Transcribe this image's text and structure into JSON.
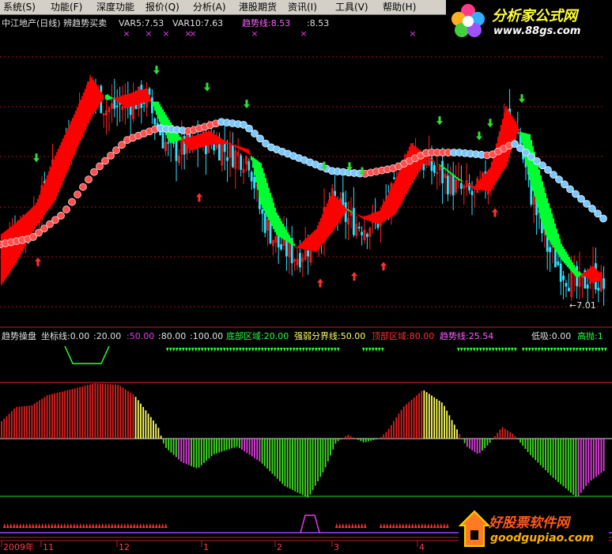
{
  "menu": [
    "系统(S)",
    "功能(F)",
    "深度功能",
    "报价(Q)",
    "分析(A)",
    "港股期货",
    "资讯(I)",
    "工具(V)",
    "帮助(H)"
  ],
  "logo": {
    "title": "分析家公式网",
    "url": "www.88gs.com"
  },
  "logo2": {
    "title": "好股票软件网",
    "url": "goodgupiao.com"
  },
  "main_header": {
    "title": "中江地产(日线) 辨趋势买卖",
    "var5_label": "VAR5:",
    "var5_value": "7.53",
    "var10_label": "VAR10:",
    "var10_value": "7.63",
    "trend_label": "趋势线:",
    "trend_value": "8.53",
    "trend2_value": ":8.53",
    "low_label": "←7.01"
  },
  "sub_header": {
    "name": "趋势操盘",
    "axis_label": "坐标线:0.00",
    "v20": ":20.00",
    "v50": ":50.00",
    "v80": ":80.00",
    "v100": ":100.00",
    "bottom_zone": "底部区域:20.00",
    "strength_line": "强弱分界线:50.00",
    "top_zone": "顶部区域:80.00",
    "trend_line": "趋势线:25.54",
    "low_absorb": "低吸:0.00",
    "high_throw": "高抛:1"
  },
  "time_axis": {
    "labels": [
      "2009年",
      "11",
      "12",
      "1",
      "2",
      "3",
      "4"
    ]
  },
  "colors": {
    "rise": "#ff2020",
    "fall": "#30e0ff",
    "up_band": "#ff0000",
    "down_band": "#00ff30",
    "ma_red": "#ff5050",
    "ma_blue": "#7ac8ff",
    "hist_red": "#e02020",
    "hist_yellow": "#ffff60",
    "hist_green": "#40e020",
    "hist_magenta": "#e040e0"
  },
  "chart_data": {
    "type": "line",
    "x": [
      "2009-10",
      "2009-11",
      "2009-12",
      "2010-01",
      "2010-02",
      "2010-03",
      "2010-04"
    ],
    "series": [
      {
        "name": "VAR5",
        "values": [
          8.3,
          10.5,
          10.4,
          9.9,
          8.6,
          9.8,
          7.5
        ]
      },
      {
        "name": "VAR10",
        "values": [
          8.4,
          10.0,
          10.3,
          10.0,
          8.8,
          9.7,
          7.6
        ]
      },
      {
        "name": "趋势线",
        "values": [
          8.1,
          8.7,
          9.9,
          9.9,
          9.2,
          9.4,
          8.5
        ]
      }
    ],
    "last_low": 7.01,
    "indicator": {
      "levels": [
        0,
        20,
        50,
        80,
        100
      ],
      "trend_line_last": 25.54
    }
  }
}
